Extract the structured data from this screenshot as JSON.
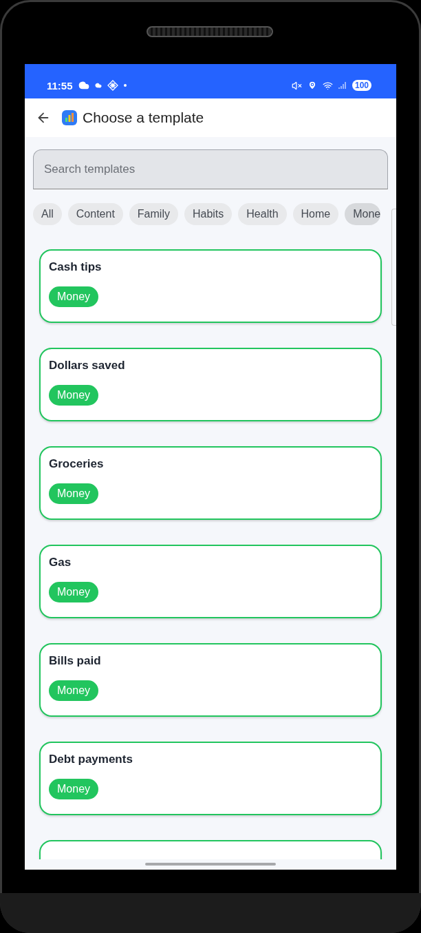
{
  "status_bar": {
    "time": "11:55",
    "battery": "100"
  },
  "header": {
    "title": "Choose a template"
  },
  "search": {
    "placeholder": "Search templates"
  },
  "filters": [
    {
      "label": "All",
      "selected": false
    },
    {
      "label": "Content",
      "selected": false
    },
    {
      "label": "Family",
      "selected": false
    },
    {
      "label": "Habits",
      "selected": false
    },
    {
      "label": "Health",
      "selected": false
    },
    {
      "label": "Home",
      "selected": false
    },
    {
      "label": "Mone",
      "selected": true
    }
  ],
  "templates": [
    {
      "title": "Cash tips",
      "tag": "Money"
    },
    {
      "title": "Dollars saved",
      "tag": "Money"
    },
    {
      "title": "Groceries",
      "tag": "Money"
    },
    {
      "title": "Gas",
      "tag": "Money"
    },
    {
      "title": "Bills paid",
      "tag": "Money"
    },
    {
      "title": "Debt payments",
      "tag": "Money"
    }
  ],
  "more_below": true
}
